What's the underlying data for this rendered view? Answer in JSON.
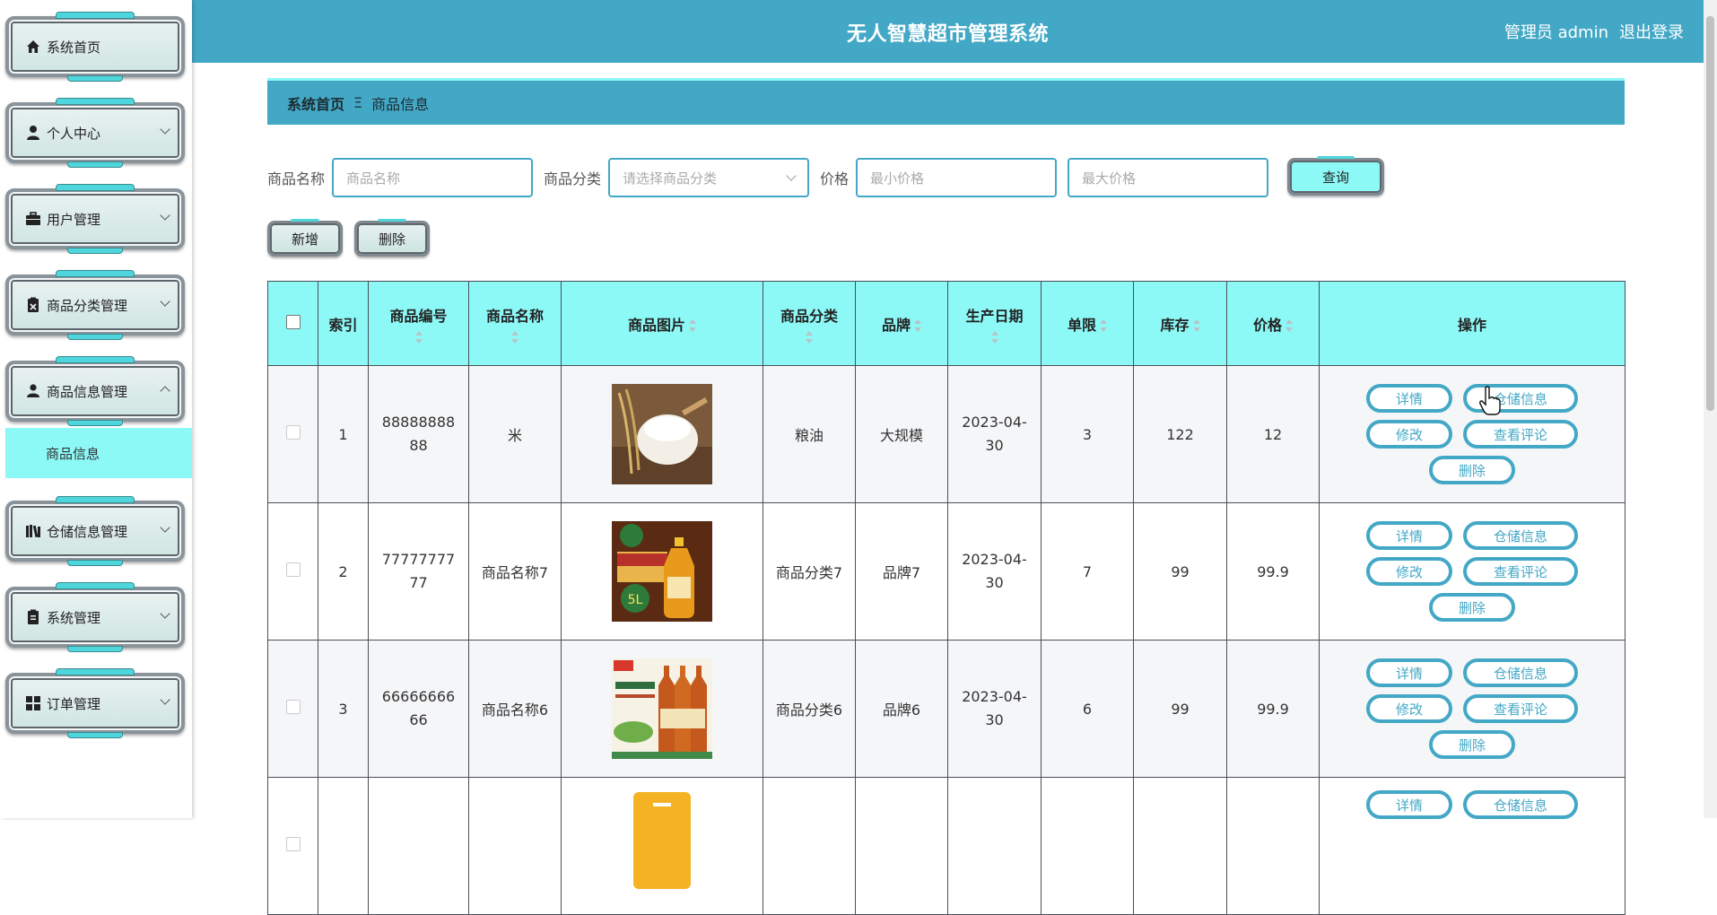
{
  "app": {
    "title": "无人智慧超市管理系统"
  },
  "header": {
    "user": "管理员 admin",
    "logout": "退出登录"
  },
  "sidebar": {
    "items": [
      {
        "label": "系统首页",
        "icon": "home-icon",
        "expandable": false
      },
      {
        "label": "个人中心",
        "icon": "person-icon",
        "expandable": true
      },
      {
        "label": "用户管理",
        "icon": "briefcase-icon",
        "expandable": true
      },
      {
        "label": "商品分类管理",
        "icon": "clipboard-x-icon",
        "expandable": true
      },
      {
        "label": "商品信息管理",
        "icon": "user-icon",
        "expandable": true,
        "expanded": true
      },
      {
        "label": "仓储信息管理",
        "icon": "book-icon",
        "expandable": true
      },
      {
        "label": "系统管理",
        "icon": "clipboard-icon",
        "expandable": true
      },
      {
        "label": "订单管理",
        "icon": "grid-icon",
        "expandable": true
      }
    ],
    "submenu": {
      "label": "商品信息"
    }
  },
  "breadcrumb": {
    "home": "系统首页",
    "separator": "Ξ",
    "current": "商品信息"
  },
  "search": {
    "name_label": "商品名称",
    "name_placeholder": "商品名称",
    "category_label": "商品分类",
    "category_placeholder": "请选择商品分类",
    "price_label": "价格",
    "min_placeholder": "最小价格",
    "max_placeholder": "最大价格",
    "query_button": "查询"
  },
  "toolbar": {
    "add": "新增",
    "delete": "删除"
  },
  "table": {
    "headers": [
      "索引",
      "商品编号",
      "商品名称",
      "商品图片",
      "商品分类",
      "品牌",
      "生产日期",
      "单限",
      "库存",
      "价格",
      "操作"
    ],
    "rows": [
      {
        "index": "1",
        "code": "8888888888",
        "name": "米",
        "category": "粮油",
        "brand": "大规模",
        "date": "2023-04-30",
        "limit": "3",
        "stock": "122",
        "price": "12"
      },
      {
        "index": "2",
        "code": "7777777777",
        "name": "商品名称7",
        "category": "商品分类7",
        "brand": "品牌7",
        "date": "2023-04-30",
        "limit": "7",
        "stock": "99",
        "price": "99.9"
      },
      {
        "index": "3",
        "code": "6666666666",
        "name": "商品名称6",
        "category": "商品分类6",
        "brand": "品牌6",
        "date": "2023-04-30",
        "limit": "6",
        "stock": "99",
        "price": "99.9"
      },
      {
        "index": "",
        "code": "",
        "name": "",
        "category": "",
        "brand": "",
        "date": "",
        "limit": "",
        "stock": "",
        "price": ""
      }
    ],
    "actions": {
      "detail": "详情",
      "storage": "仓储信息",
      "edit": "修改",
      "reviews": "查看评论",
      "delete": "删除"
    }
  },
  "colors": {
    "accent": "#43a8c6",
    "highlight": "#8cf9f7",
    "border": "#4a4e57"
  }
}
